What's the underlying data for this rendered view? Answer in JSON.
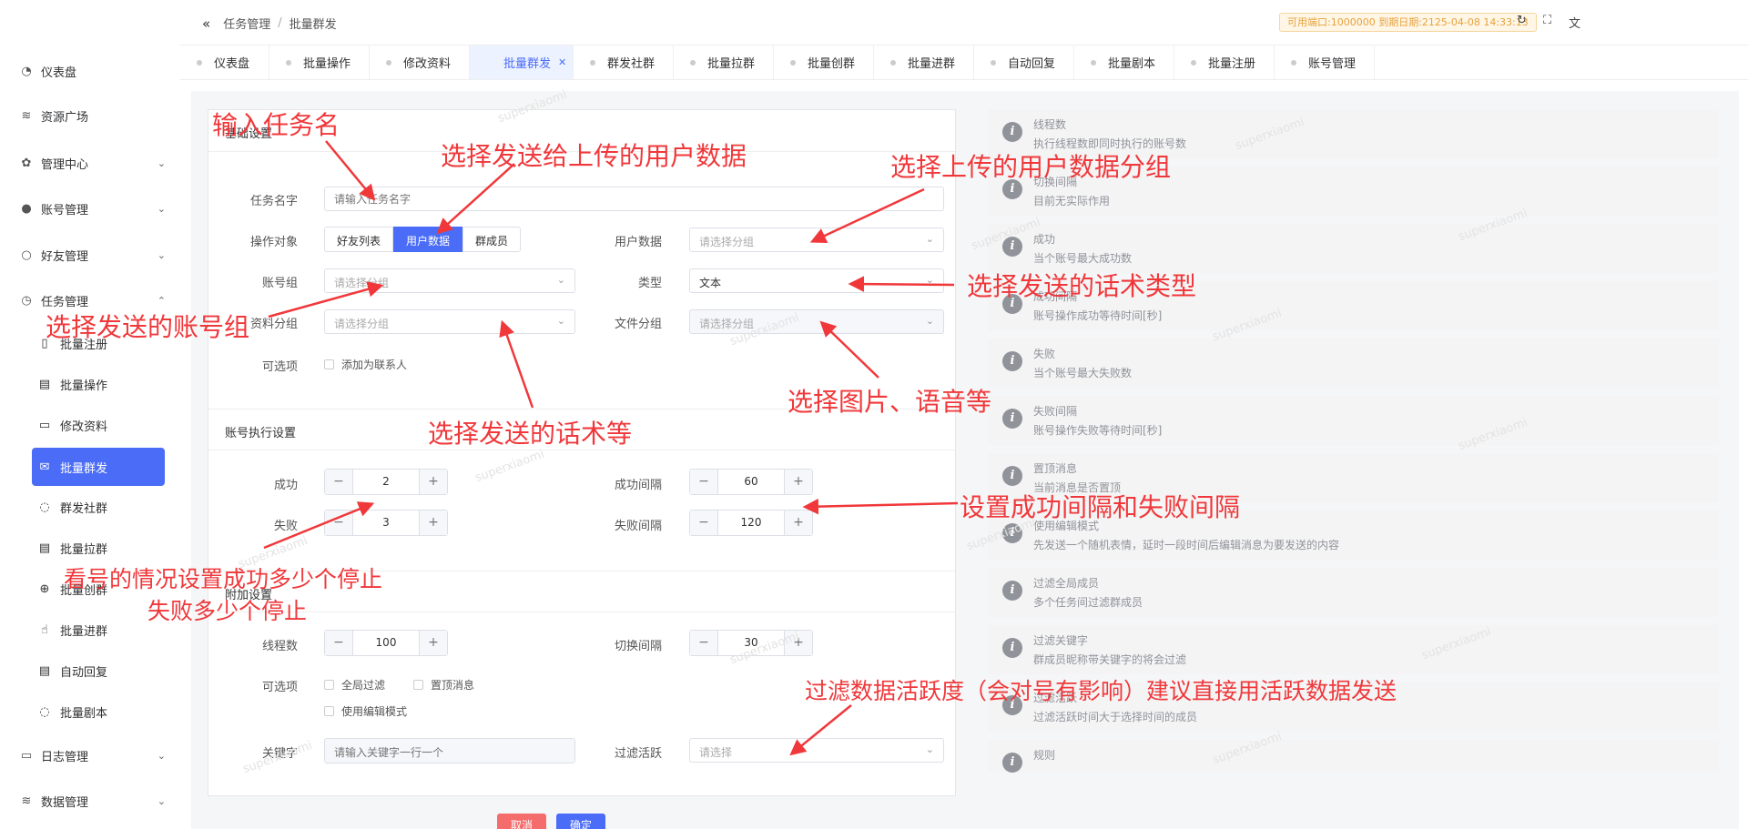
{
  "sidebar": {
    "items": [
      {
        "label": "仪表盘",
        "icon": "dashboard-icon"
      },
      {
        "label": "资源广场",
        "icon": "database-icon"
      },
      {
        "label": "管理中心",
        "icon": "gear-icon"
      },
      {
        "label": "账号管理",
        "icon": "user-filled-icon"
      },
      {
        "label": "好友管理",
        "icon": "user-icon"
      },
      {
        "label": "任务管理",
        "icon": "clock-icon"
      }
    ],
    "sub_items": [
      {
        "label": "批量注册",
        "icon": "phone-icon"
      },
      {
        "label": "批量操作",
        "icon": "clipboard-icon"
      },
      {
        "label": "修改资料",
        "icon": "document-icon"
      },
      {
        "label": "批量群发",
        "icon": "mail-icon"
      },
      {
        "label": "群发社群",
        "icon": "chat-icon"
      },
      {
        "label": "批量拉群",
        "icon": "list-icon"
      },
      {
        "label": "批量创群",
        "icon": "add-circle-icon"
      },
      {
        "label": "批量进群",
        "icon": "pointer-icon"
      },
      {
        "label": "自动回复",
        "icon": "reply-icon"
      },
      {
        "label": "批量剧本",
        "icon": "script-icon"
      }
    ],
    "bottom_items": [
      {
        "label": "日志管理",
        "icon": "log-icon"
      },
      {
        "label": "数据管理",
        "icon": "database-icon"
      }
    ]
  },
  "header": {
    "breadcrumb": [
      "任务管理",
      "批量群发"
    ],
    "separator": "/",
    "license": "可用端口:1000000 到期日期:2125-04-08 14:33:13"
  },
  "tabs": [
    {
      "label": "仪表盘"
    },
    {
      "label": "批量操作"
    },
    {
      "label": "修改资料"
    },
    {
      "label": "批量群发",
      "active": true
    },
    {
      "label": "群发社群"
    },
    {
      "label": "批量拉群"
    },
    {
      "label": "批量创群"
    },
    {
      "label": "批量进群"
    },
    {
      "label": "自动回复"
    },
    {
      "label": "批量剧本"
    },
    {
      "label": "批量注册"
    },
    {
      "label": "账号管理"
    }
  ],
  "basic": {
    "section_title": "基础设置",
    "task_name_label": "任务名字",
    "task_name_placeholder": "请输入任务名字",
    "target_label": "操作对象",
    "target_options": [
      "好友列表",
      "用户数据",
      "群成员"
    ],
    "account_group_label": "账号组",
    "account_group_placeholder": "请选择分组",
    "material_group_label": "资料分组",
    "material_group_placeholder": "请选择分组",
    "optional_label": "可选项",
    "add_contact_label": "添加为联系人",
    "user_data_label": "用户数据",
    "user_data_placeholder": "请选择分组",
    "type_label": "类型",
    "type_value": "文本",
    "file_group_label": "文件分组",
    "file_group_placeholder": "请选择分组"
  },
  "exec": {
    "section_title": "账号执行设置",
    "success_label": "成功",
    "success_value": "2",
    "fail_label": "失败",
    "fail_value": "3",
    "success_interval_label": "成功间隔",
    "success_interval_value": "60",
    "fail_interval_label": "失败间隔",
    "fail_interval_value": "120"
  },
  "extra": {
    "section_title": "附加设置",
    "threads_label": "线程数",
    "threads_value": "100",
    "switch_interval_label": "切换间隔",
    "switch_interval_value": "30",
    "optional_label": "可选项",
    "global_filter_label": "全局过滤",
    "pin_message_label": "置顶消息",
    "edit_mode_label": "使用编辑模式",
    "keyword_label": "关键字",
    "keyword_placeholder": "请输入关键字一行一个",
    "filter_active_label": "过滤活跃",
    "filter_active_placeholder": "请选择"
  },
  "stepper": {
    "minus": "−",
    "plus": "+"
  },
  "buttons": {
    "cancel": "取消",
    "confirm": "确定"
  },
  "help": [
    {
      "title": "线程数",
      "desc": "执行线程数即同时执行的账号数"
    },
    {
      "title": "切换间隔",
      "desc": "目前无实际作用"
    },
    {
      "title": "成功",
      "desc": "当个账号最大成功数"
    },
    {
      "title": "成功间隔",
      "desc": "账号操作成功等待时间[秒]"
    },
    {
      "title": "失败",
      "desc": "当个账号最大失败数"
    },
    {
      "title": "失败间隔",
      "desc": "账号操作失败等待时间[秒]"
    },
    {
      "title": "置顶消息",
      "desc": "当前消息是否置顶"
    },
    {
      "title": "使用编辑模式",
      "desc": "先发送一个随机表情，延时一段时间后编辑消息为要发送的内容"
    },
    {
      "title": "过滤全局成员",
      "desc": "多个任务间过滤群成员"
    },
    {
      "title": "过滤关键字",
      "desc": "群成员昵称带关键字的将会过滤"
    },
    {
      "title": "过滤活跃",
      "desc": "过滤活跃时间大于选择时间的成员"
    },
    {
      "title": "规则",
      "desc": ""
    }
  ],
  "watermark": "superxiaomi",
  "annotations": {
    "a1": "输入任务名",
    "a2": "选择发送给上传的用户数据",
    "a3": "选择上传的用户数据分组",
    "a4": "选择发送的话术类型",
    "a5": "选择发送的账号组",
    "a6": "选择图片、语音等",
    "a7": "选择发送的话术等",
    "a8": "设置成功间隔和失败间隔",
    "a9_line1": "看号的情况设置成功多少个停止",
    "a9_line2": "失败多少个停止",
    "a10": "过滤数据活跃度（会对号有影响）建议直接用活跃数据发送"
  },
  "colors": {
    "accent": "#4b6cf7",
    "annotation": "#f0383b",
    "cancel": "#f56c6c"
  }
}
